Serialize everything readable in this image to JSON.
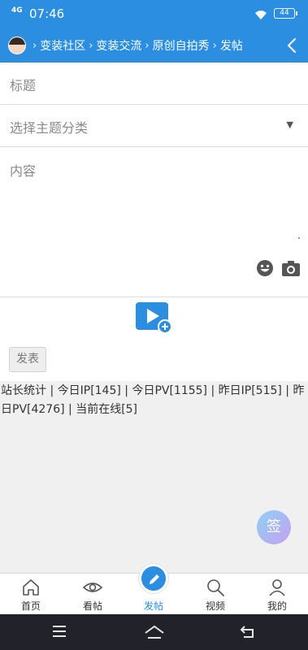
{
  "status_bar": {
    "network": "4G",
    "time": "07:46",
    "battery": "44"
  },
  "breadcrumb": {
    "items": [
      "变装社区",
      "变装交流",
      "原创自拍秀",
      "发帖"
    ],
    "separator": "›"
  },
  "form": {
    "title_placeholder": "标题",
    "category_placeholder": "选择主题分类",
    "content_placeholder": "内容",
    "submit_label": "发表"
  },
  "stats_text": "站长统计 | 今日IP[145] | 今日PV[1155] | 昨日IP[515] | 昨日PV[4276] | 当前在线[5]",
  "sign_label": "签",
  "tabs": [
    {
      "label": "首页",
      "icon": "home-icon"
    },
    {
      "label": "看帖",
      "icon": "eye-icon"
    },
    {
      "label": "发帖",
      "icon": "pencil-icon",
      "active": true
    },
    {
      "label": "视频",
      "icon": "search-icon"
    },
    {
      "label": "我的",
      "icon": "user-icon"
    }
  ],
  "colors": {
    "accent": "#2b8ee0",
    "background_gray": "#f0f0f0",
    "system_nav": "#22232a"
  }
}
